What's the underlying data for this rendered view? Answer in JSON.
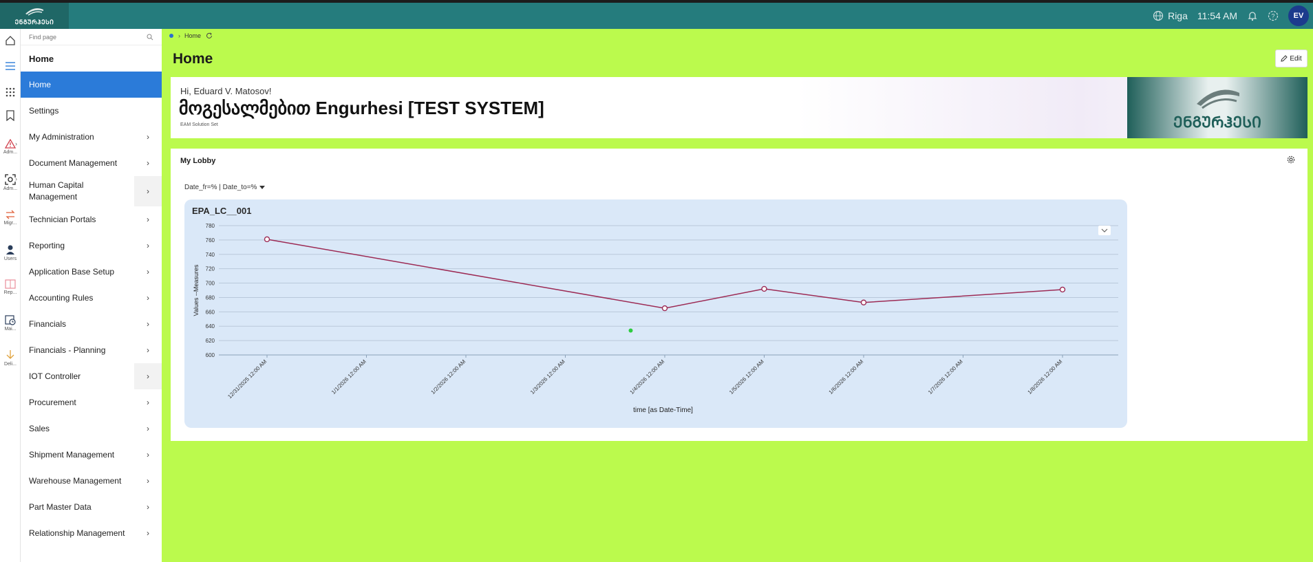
{
  "topbar": {
    "logo_text": "ᲔᲜᲒᲣᲠᲰᲔᲡᲘ",
    "location": "Riga",
    "time": "11:54 AM",
    "avatar_initials": "EV"
  },
  "rail": {
    "items": [
      {
        "icon": "home-icon",
        "caption": ""
      },
      {
        "icon": "menu-icon",
        "caption": ""
      },
      {
        "icon": "apps-grid-icon",
        "caption": ""
      },
      {
        "icon": "bookmark-icon",
        "caption": ""
      },
      {
        "icon": "alert-triangle-icon",
        "caption": "Adm..."
      },
      {
        "icon": "scan-icon",
        "caption": "Adm..."
      },
      {
        "icon": "transfer-arrows-icon",
        "caption": "Migr..."
      },
      {
        "icon": "user-icon",
        "caption": "Users"
      },
      {
        "icon": "report-book-icon",
        "caption": "Rep..."
      },
      {
        "icon": "calendar-clock-icon",
        "caption": "Mai..."
      },
      {
        "icon": "download-arrow-icon",
        "caption": "Deli..."
      }
    ]
  },
  "sidebar": {
    "search_placeholder": "Find page",
    "title": "Home",
    "items": [
      {
        "label": "Home"
      },
      {
        "label": "Settings"
      },
      {
        "label": "My Administration"
      },
      {
        "label": "Document Management"
      },
      {
        "label": "Human Capital Management"
      },
      {
        "label": "Technician Portals"
      },
      {
        "label": "Reporting"
      },
      {
        "label": "Application Base Setup"
      },
      {
        "label": "Accounting Rules"
      },
      {
        "label": "Financials"
      },
      {
        "label": "Financials - Planning"
      },
      {
        "label": "IOT Controller"
      },
      {
        "label": "Procurement"
      },
      {
        "label": "Sales"
      },
      {
        "label": "Shipment Management"
      },
      {
        "label": "Warehouse Management"
      },
      {
        "label": "Part Master Data"
      },
      {
        "label": "Relationship Management"
      }
    ]
  },
  "breadcrumb": {
    "current": "Home"
  },
  "page": {
    "title": "Home",
    "edit_label": "Edit"
  },
  "banner": {
    "greeting": "Hi, Eduard V. Matosov!",
    "welcome": "მოგესალმებით Engurhesi [TEST SYSTEM]",
    "subtitle": "EAM Solution Set",
    "logo_text": "ᲔᲜᲒᲣᲠᲰᲔᲡᲘ"
  },
  "lobby": {
    "title": "My Lobby",
    "filter": "Date_fr=% | Date_to=%"
  },
  "chart_data": {
    "type": "line",
    "title": "EPA_LC__001",
    "xlabel": "time [as Date-Time]",
    "ylabel": "Values --Measures",
    "ylim": [
      600,
      780
    ],
    "yticks": [
      600,
      620,
      640,
      660,
      680,
      700,
      720,
      740,
      760,
      780
    ],
    "x_ticks": [
      "12/31/2025 12:00 AM",
      "1/1/2026 12:00 AM",
      "1/2/2026 12:00 AM",
      "1/3/2026 12:00 AM",
      "1/4/2026 12:00 AM",
      "1/5/2026 12:00 AM",
      "1/6/2026 12:00 AM",
      "1/7/2026 12:00 AM",
      "1/8/2026 12:00 AM"
    ],
    "grid": true,
    "legend": "none",
    "series": [
      {
        "color": "#9c2a54",
        "points": [
          {
            "x": "12/31/2025 12:00 AM",
            "y": 761
          },
          {
            "x": "1/4/2026 12:00 AM",
            "y": 665
          },
          {
            "x": "1/5/2026 12:00 AM",
            "y": 692
          },
          {
            "x": "1/6/2026 12:00 AM",
            "y": 673
          },
          {
            "x": "1/8/2026 12:00 AM",
            "y": 691
          }
        ]
      }
    ],
    "extra_point": {
      "x": "1/3/2026 12:00 AM",
      "y": 634,
      "color": "#2ecc40"
    }
  }
}
